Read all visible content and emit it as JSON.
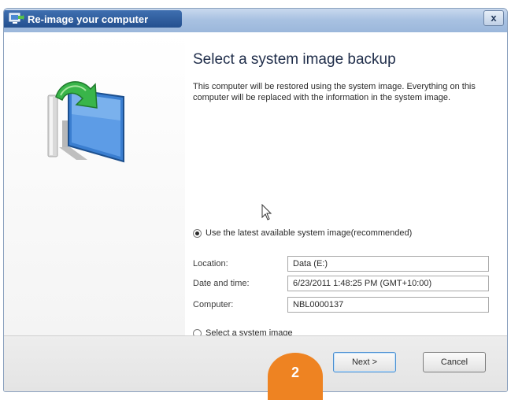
{
  "window": {
    "title": "Re-image your computer",
    "close_glyph": "x"
  },
  "content": {
    "heading": "Select a system image backup",
    "description": "This computer will be restored using the system image. Everything on this computer will be replaced with the information in the system image."
  },
  "options": {
    "latest_label": "Use the latest available system image(recommended)",
    "latest_checked": true,
    "select_label": "Select a system image",
    "select_checked": false
  },
  "details": {
    "location_label": "Location:",
    "location_value": "Data (E:)",
    "datetime_label": "Date and time:",
    "datetime_value": "6/23/2011 1:48:25 PM (GMT+10:00)",
    "computer_label": "Computer:",
    "computer_value": "NBL0000137"
  },
  "buttons": {
    "next": "Next >",
    "cancel": "Cancel"
  },
  "step_badge": "2",
  "colors": {
    "accent_orange": "#ee8322",
    "title_blue": "#2f5fa3"
  },
  "icons": {
    "app": "computer-restore-icon",
    "hero": "monitor-restore-arrow-icon",
    "cursor": "mouse-pointer-icon"
  }
}
